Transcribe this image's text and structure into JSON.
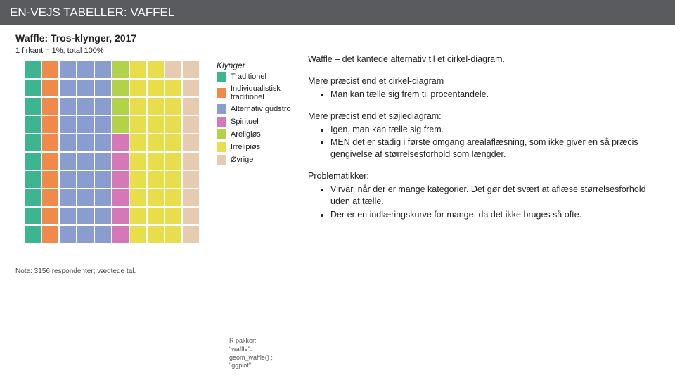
{
  "header": "EN-VEJS TABELLER: VAFFEL",
  "chart": {
    "title": "Waffle: Tros-klynger, 2017",
    "subtitle": "1 firkant = 1%; total 100%",
    "legend_title": "Klynger",
    "note": "Note: 3156 respondenter; vægtede tal."
  },
  "colors": {
    "Traditionel": "#3eb591",
    "Individualistisk traditionel": "#f08a4b",
    "Alternativ gudstro": "#8a9dd1",
    "Spirituel": "#d678b8",
    "Areligiøs": "#b2d24a",
    "Irrelipiøs": "#e8dd4a",
    "Øvrige": "#e7cbb1"
  },
  "legend_items": [
    "Traditionel",
    "Individualistisk traditionel",
    "Alternativ gudstro",
    "Spirituel",
    "Areligiøs",
    "Irrelipiøs",
    "Øvrige"
  ],
  "chart_data": {
    "type": "waffle",
    "title": "Waffle: Tros-klynger, 2017",
    "categories": [
      "Traditionel",
      "Individualistisk traditionel",
      "Alternativ gudstro",
      "Spirituel",
      "Areligiøs",
      "Irrelipiøs",
      "Øvrige"
    ],
    "values": [
      10,
      10,
      30,
      6,
      4,
      29,
      11
    ],
    "unit": "percent",
    "total": 100,
    "grid": {
      "rows": 10,
      "cols": 10
    },
    "fill_order": "column-major-left-to-right-bottom-to-top",
    "note": "3156 respondenter; vægtede tal."
  },
  "text": {
    "intro": "Waffle – det kantede alternativ til et cirkel-diagram.",
    "sec1_head": "Mere præcist end et cirkel-diagram",
    "sec1_b1": "Man kan tælle sig frem til procentandele.",
    "sec2_head": "Mere præcist end et søjlediagram:",
    "sec2_b1": "Igen, man kan tælle sig frem.",
    "sec2_b2a": "MEN",
    "sec2_b2b": " det er stadig i første omgang arealaflæsning, som ikke giver en så præcis gengivelse af størrelsesforhold som længder.",
    "sec3_head": "Problematikker:",
    "sec3_b1": "Virvar, når der er mange kategorier. Det gør det svært at aflæse størrelsesforhold uden at tælle.",
    "sec3_b2": "Der er en indlæringskurve for mange, da det ikke bruges så ofte.",
    "footnote_label": "R pakker:",
    "footnote_l1": "\"waffle\": geom_waffle() ;",
    "footnote_l2": "\"ggplot\""
  }
}
